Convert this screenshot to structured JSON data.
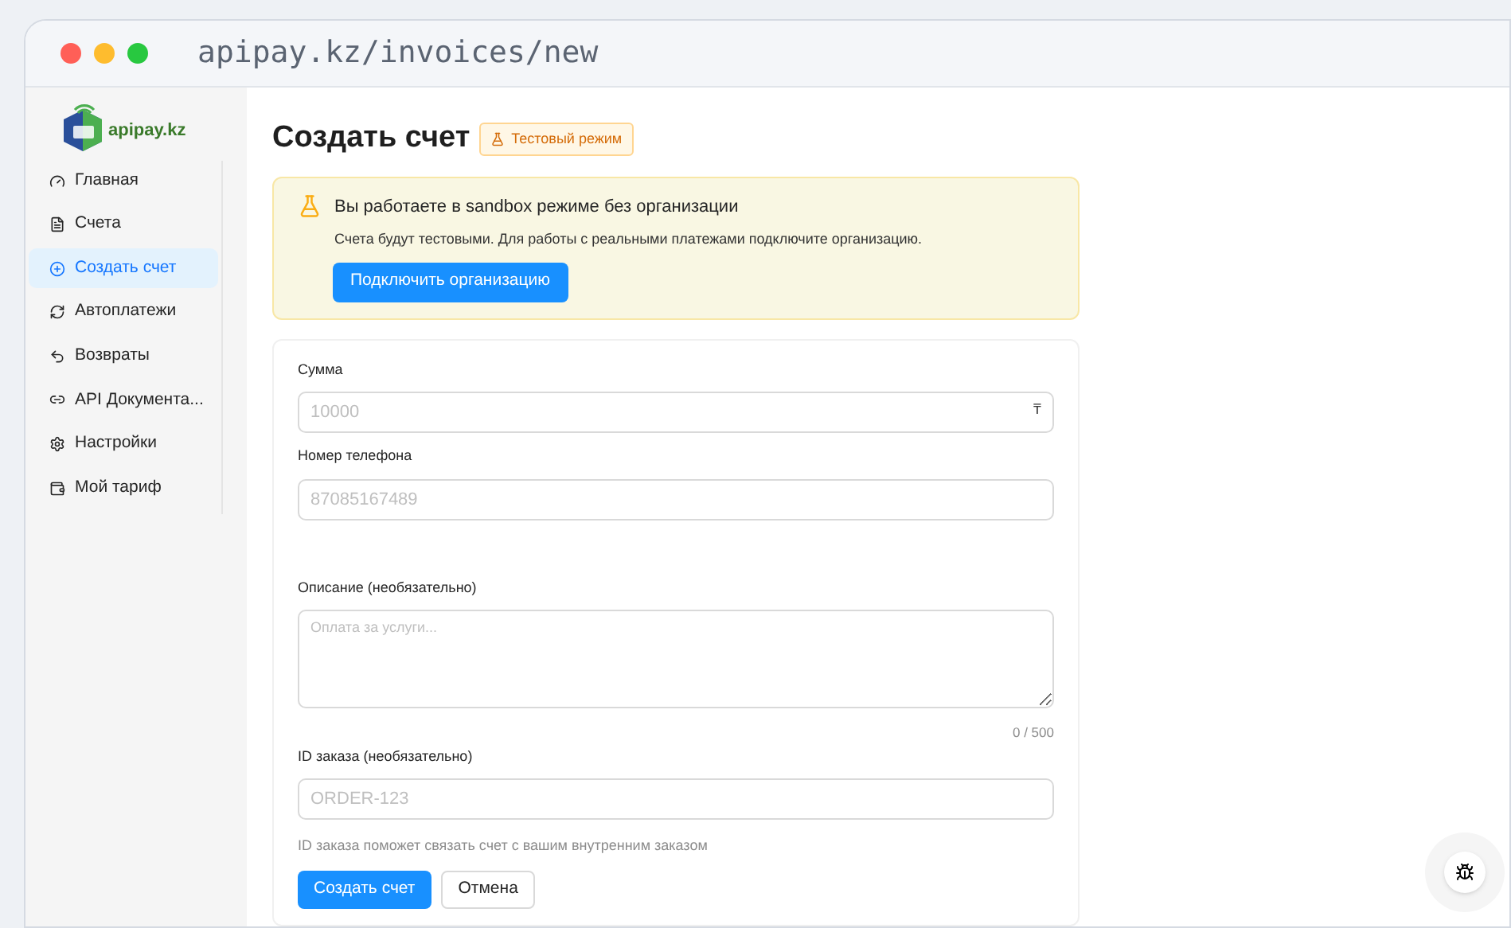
{
  "browser": {
    "url": "apipay.kz/invoices/new"
  },
  "logo": {
    "text": "apipay.kz"
  },
  "sidebar": {
    "items": [
      {
        "label": "Главная",
        "selected": false
      },
      {
        "label": "Счета",
        "selected": false
      },
      {
        "label": "Создать счет",
        "selected": true
      },
      {
        "label": "Автоплатежи",
        "selected": false
      },
      {
        "label": "Возвраты",
        "selected": false
      },
      {
        "label": "API Документа...",
        "selected": false
      },
      {
        "label": "Настройки",
        "selected": false
      },
      {
        "label": "Мой тариф",
        "selected": false
      }
    ]
  },
  "page": {
    "title": "Создать счет",
    "badge": "Тестовый режим"
  },
  "alert": {
    "title": "Вы работаете в sandbox режиме без организации",
    "text": "Счета будут тестовыми. Для работы с реальными платежами подключите организацию.",
    "button": "Подключить организацию"
  },
  "form": {
    "fields": [
      {
        "kind": "input",
        "label": "Сумма",
        "placeholder": "10000",
        "suffix": "₸"
      },
      {
        "kind": "input",
        "label": "Номер телефона",
        "placeholder": "87085167489"
      },
      {
        "kind": "textarea",
        "label": "Описание (необязательно)",
        "placeholder": "Оплата за услуги...",
        "counter": "0 / 500"
      },
      {
        "kind": "input",
        "label": "ID заказа (необязательно)",
        "placeholder": "ORDER-123",
        "hint": "ID заказа поможет связать счет с вашим внутренним заказом"
      }
    ],
    "buttons": [
      {
        "label": "Создать счет",
        "primary": true
      },
      {
        "label": "Отмена",
        "primary": false
      }
    ]
  }
}
